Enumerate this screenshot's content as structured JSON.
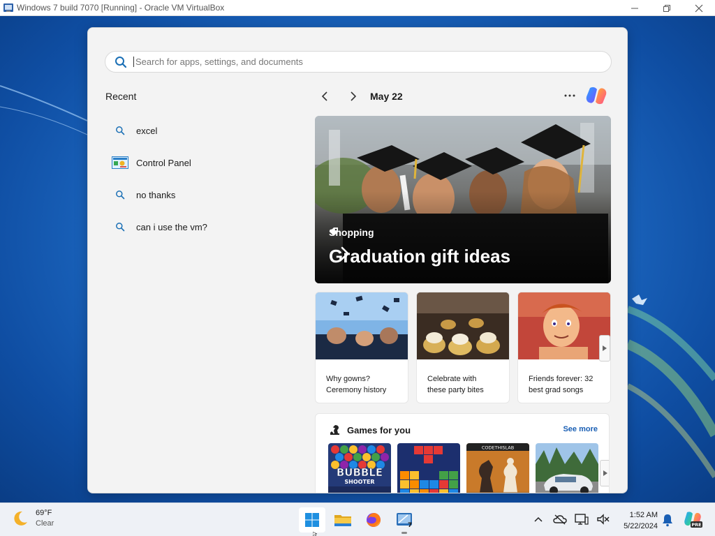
{
  "window": {
    "title": "Windows 7 build 7070 [Running] - Oracle VM VirtualBox",
    "icons": [
      "virtualbox-icon",
      "minimize-icon",
      "restore-icon",
      "close-icon"
    ]
  },
  "search": {
    "placeholder": "Search for apps, settings, and documents",
    "value": ""
  },
  "recent": {
    "title": "Recent",
    "items": [
      {
        "label": "excel",
        "icon": "search-icon"
      },
      {
        "label": "Control Panel",
        "icon": "control-panel-icon"
      },
      {
        "label": "no thanks",
        "icon": "search-icon"
      },
      {
        "label": "can i use the vm?",
        "icon": "search-icon"
      }
    ]
  },
  "highlights": {
    "date": "May 22",
    "hero": {
      "tag": "Shopping",
      "headline": "Graduation gift ideas"
    },
    "cards": [
      {
        "line1": "Why gowns?",
        "line2": "Ceremony history"
      },
      {
        "line1": "Celebrate with",
        "line2": "these party bites"
      },
      {
        "line1": "Friends forever: 32",
        "line2": "best grad songs"
      }
    ]
  },
  "games": {
    "title": "Games for you",
    "see_more": "See more",
    "tiles": [
      {
        "line1": "BUBBLE",
        "line2": "SHOOTER"
      },
      {
        "line1": "",
        "line2": ""
      },
      {
        "line1": "CODETHISLAB",
        "line2": ""
      },
      {
        "line1": "",
        "line2": ""
      }
    ]
  },
  "taskbar": {
    "weather_temp": "69°F",
    "weather_cond": "Clear",
    "time": "1:52 AM",
    "date": "5/22/2024",
    "apps": [
      "start-icon",
      "file-explorer-icon",
      "firefox-icon",
      "virtualbox-taskbar-icon"
    ],
    "tray_icons": [
      "chevron-up-icon",
      "onedrive-icon",
      "display-icon",
      "volume-muted-icon",
      "notifications-bell-icon",
      "copilot-pre-icon"
    ],
    "copilot_badge": "PRE",
    "vm_badge": "7"
  },
  "colors": {
    "accent": "#1a5fb4",
    "desktop": "#1f6cc6",
    "flyout_bg": "#f3f3f3",
    "taskbar_bg": "#eef1f6"
  }
}
